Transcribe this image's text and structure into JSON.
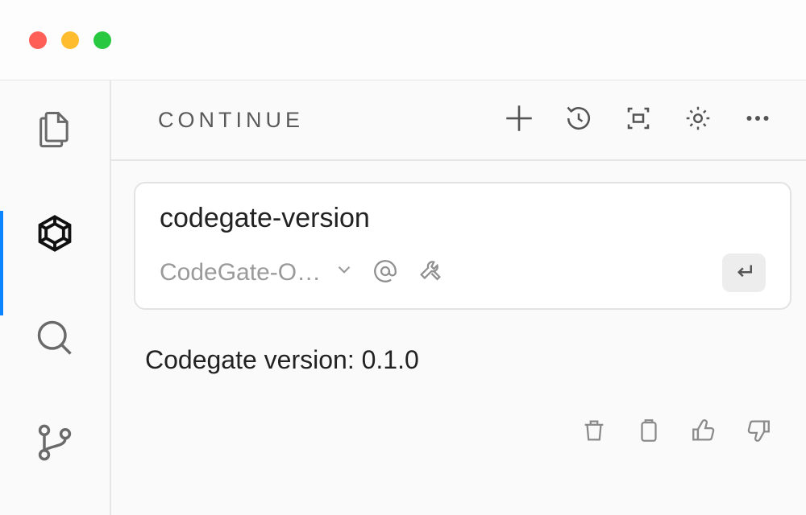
{
  "panel": {
    "title": "CONTINUE"
  },
  "input": {
    "text": "codegate-version",
    "model_label": "CodeGate-O…"
  },
  "response": {
    "text": "Codegate version: 0.1.0"
  }
}
